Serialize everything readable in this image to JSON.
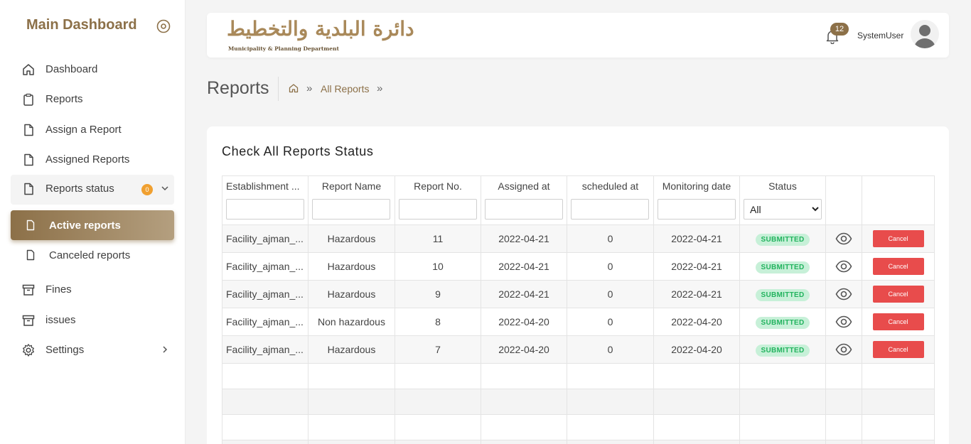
{
  "sidebar": {
    "brand": "Main Dashboard",
    "items": [
      {
        "label": "Dashboard",
        "icon": "home-icon"
      },
      {
        "label": "Reports",
        "icon": "clipboard-icon"
      },
      {
        "label": "Assign a Report",
        "icon": "file-icon"
      },
      {
        "label": "Assigned Reports",
        "icon": "file-icon"
      },
      {
        "label": "Reports status",
        "icon": "file-icon",
        "badge": "0"
      },
      {
        "label": "Fines",
        "icon": "archive-icon"
      },
      {
        "label": "issues",
        "icon": "archive-icon"
      },
      {
        "label": "Settings",
        "icon": "gear-icon"
      }
    ],
    "sub_items": [
      {
        "label": "Active reports",
        "active": true
      },
      {
        "label": "Canceled reports",
        "active": false
      }
    ]
  },
  "header": {
    "logo_ar": "دائرة البلدية والتخطيط",
    "logo_en": "Municipality & Planning Department",
    "notification_count": "12",
    "username": "SystemUser"
  },
  "page": {
    "title": "Reports",
    "breadcrumb_link": "All Reports",
    "breadcrumb_sep": "»"
  },
  "card": {
    "title": "Check All Reports Status",
    "columns": [
      "Establishment ...",
      "Report Name",
      "Report No.",
      "Assigned at",
      "scheduled at",
      "Monitoring date",
      "Status"
    ],
    "status_filter": "All",
    "rows": [
      {
        "establishment": "Facility_ajman_...",
        "report_name": "Hazardous",
        "report_no": "11",
        "assigned_at": "2022-04-21",
        "scheduled_at": "0",
        "monitoring_date": "2022-04-21",
        "status": "SUBMITTED",
        "action": "Cancel"
      },
      {
        "establishment": "Facility_ajman_...",
        "report_name": "Hazardous",
        "report_no": "10",
        "assigned_at": "2022-04-21",
        "scheduled_at": "0",
        "monitoring_date": "2022-04-21",
        "status": "SUBMITTED",
        "action": "Cancel"
      },
      {
        "establishment": "Facility_ajman_...",
        "report_name": "Hazardous",
        "report_no": "9",
        "assigned_at": "2022-04-21",
        "scheduled_at": "0",
        "monitoring_date": "2022-04-21",
        "status": "SUBMITTED",
        "action": "Cancel"
      },
      {
        "establishment": "Facility_ajman_...",
        "report_name": "Non hazardous",
        "report_no": "8",
        "assigned_at": "2022-04-20",
        "scheduled_at": "0",
        "monitoring_date": "2022-04-20",
        "status": "SUBMITTED",
        "action": "Cancel"
      },
      {
        "establishment": "Facility_ajman_...",
        "report_name": "Hazardous",
        "report_no": "7",
        "assigned_at": "2022-04-20",
        "scheduled_at": "0",
        "monitoring_date": "2022-04-20",
        "status": "SUBMITTED",
        "action": "Cancel"
      }
    ]
  },
  "colors": {
    "accent": "#8c7048",
    "status_green": "#22b35e",
    "cancel_red": "#e84c4c",
    "badge_orange": "#f0a030"
  }
}
